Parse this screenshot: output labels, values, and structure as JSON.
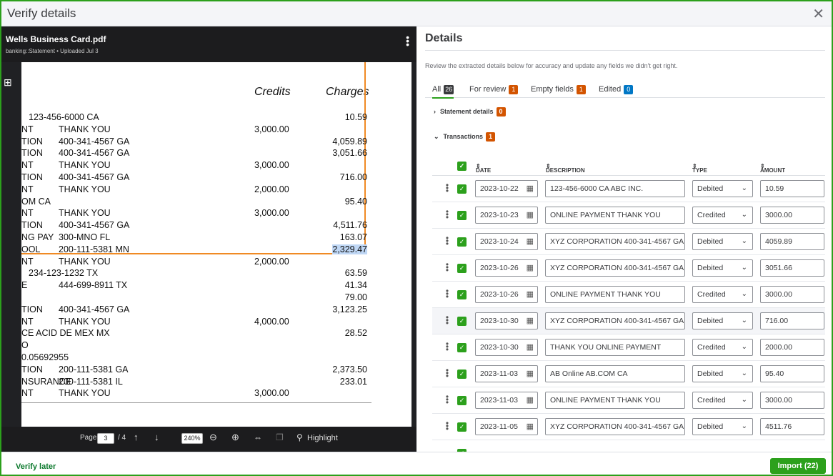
{
  "window": {
    "title": "Verify details",
    "close_icon": "close-icon"
  },
  "viewer": {
    "file_name": "Wells Business Card.pdf",
    "meta": "banking::Statement  •  Uploaded Jul 3",
    "statement": {
      "col_credits": "Credits",
      "col_charges": "Charges",
      "rows": [
        {
          "d": "",
          "d2": "123-456-6000 CA",
          "cr": "",
          "ch": "10.59"
        },
        {
          "d": "NT",
          "d2": "THANK YOU",
          "cr": "3,000.00",
          "ch": ""
        },
        {
          "d": "TION",
          "d2": "400-341-4567 GA",
          "cr": "",
          "ch": "4,059.89"
        },
        {
          "d": "TION",
          "d2": "400-341-4567 GA",
          "cr": "",
          "ch": "3,051.66"
        },
        {
          "d": "NT",
          "d2": "THANK YOU",
          "cr": "3,000.00",
          "ch": ""
        },
        {
          "d": "TION",
          "d2": "400-341-4567 GA",
          "cr": "",
          "ch": "716.00"
        },
        {
          "d": "NT",
          "d2": "THANK YOU",
          "cr": "2,000.00",
          "ch": ""
        },
        {
          "d": "OM CA",
          "d2": "",
          "cr": "",
          "ch": "95.40"
        },
        {
          "d": "NT",
          "d2": "THANK YOU",
          "cr": "3,000.00",
          "ch": ""
        },
        {
          "d": "TION",
          "d2": "400-341-4567 GA",
          "cr": "",
          "ch": "4,511.76"
        },
        {
          "d": "NG PAY",
          "d2": "300-MNO FL",
          "cr": "",
          "ch": "163.07"
        },
        {
          "d": "OOL",
          "d2": "200-111-5381 MN",
          "cr": "",
          "ch": "2,329.47"
        },
        {
          "d": "NT",
          "d2": "THANK YOU",
          "cr": "2,000.00",
          "ch": ""
        },
        {
          "d": "",
          "d2": "234-123-1232 TX",
          "cr": "",
          "ch": "63.59"
        },
        {
          "d": "E",
          "d2": "444-699-8911 TX",
          "cr": "",
          "ch": "41.34"
        },
        {
          "d": "",
          "d2": "",
          "cr": "",
          "ch": "79.00"
        },
        {
          "d": "TION",
          "d2": "400-341-4567 GA",
          "cr": "",
          "ch": "3,123.25"
        },
        {
          "d": "NT",
          "d2": "THANK YOU",
          "cr": "4,000.00",
          "ch": ""
        },
        {
          "d": "CE ACID DE MEX MX",
          "d2": "",
          "cr": "",
          "ch": "28.52"
        },
        {
          "d": "O",
          "d2": "",
          "cr": "",
          "ch": ""
        },
        {
          "d": "0.05692955",
          "d2": "",
          "cr": "",
          "ch": ""
        },
        {
          "d": "TION",
          "d2": "200-111-5381 GA",
          "cr": "",
          "ch": "2,373.50"
        },
        {
          "d": "NSURANCE",
          "d2": "200-111-5381 IL",
          "cr": "",
          "ch": "233.01"
        },
        {
          "d": "NT",
          "d2": "THANK YOU",
          "cr": "3,000.00",
          "ch": ""
        }
      ]
    },
    "footer": {
      "page_label": "Page",
      "page_value": "3",
      "page_total": "/ 4",
      "zoom": "240%",
      "highlight": "Highlight"
    }
  },
  "details": {
    "title": "Details",
    "intro": "Review the extracted details below for accuracy and update any fields we didn't get right.",
    "tabs": [
      {
        "label": "All",
        "count": "26",
        "color": "#393a3d"
      },
      {
        "label": "For review",
        "count": "1",
        "color": "#d35400"
      },
      {
        "label": "Empty fields",
        "count": "1",
        "color": "#d35400"
      },
      {
        "label": "Edited",
        "count": "0",
        "color": "#0077c5"
      }
    ],
    "sections": {
      "statement": {
        "label": "Statement details",
        "count": "0"
      },
      "transactions": {
        "label": "Transactions",
        "count": "1"
      }
    },
    "columns": {
      "date": "DATE",
      "description": "DESCRIPTION",
      "type": "TYPE",
      "amount": "AMOUNT"
    },
    "rows": [
      {
        "date": "2023-10-22",
        "desc": "123-456-6000 CA ABC INC.",
        "type": "Debited",
        "amount": "10.59"
      },
      {
        "date": "2023-10-23",
        "desc": "ONLINE PAYMENT THANK YOU",
        "type": "Credited",
        "amount": "3000.00"
      },
      {
        "date": "2023-10-24",
        "desc": "XYZ CORPORATION 400-341-4567 GA",
        "type": "Debited",
        "amount": "4059.89"
      },
      {
        "date": "2023-10-26",
        "desc": "XYZ CORPORATION 400-341-4567 GA",
        "type": "Debited",
        "amount": "3051.66"
      },
      {
        "date": "2023-10-26",
        "desc": "ONLINE PAYMENT THANK YOU",
        "type": "Credited",
        "amount": "3000.00"
      },
      {
        "date": "2023-10-30",
        "desc": "XYZ CORPORATION 400-341-4567 GA",
        "type": "Debited",
        "amount": "716.00"
      },
      {
        "date": "2023-10-30",
        "desc": "THANK YOU ONLINE PAYMENT",
        "type": "Credited",
        "amount": "2000.00"
      },
      {
        "date": "2023-11-03",
        "desc": "AB Online AB.COM CA",
        "type": "Debited",
        "amount": "95.40"
      },
      {
        "date": "2023-11-03",
        "desc": "ONLINE PAYMENT THANK YOU",
        "type": "Credited",
        "amount": "3000.00"
      },
      {
        "date": "2023-11-05",
        "desc": "XYZ CORPORATION 400-341-4567 GA",
        "type": "Debited",
        "amount": "4511.76"
      }
    ]
  },
  "footer": {
    "verify_later": "Verify later",
    "import": "Import (22)"
  }
}
